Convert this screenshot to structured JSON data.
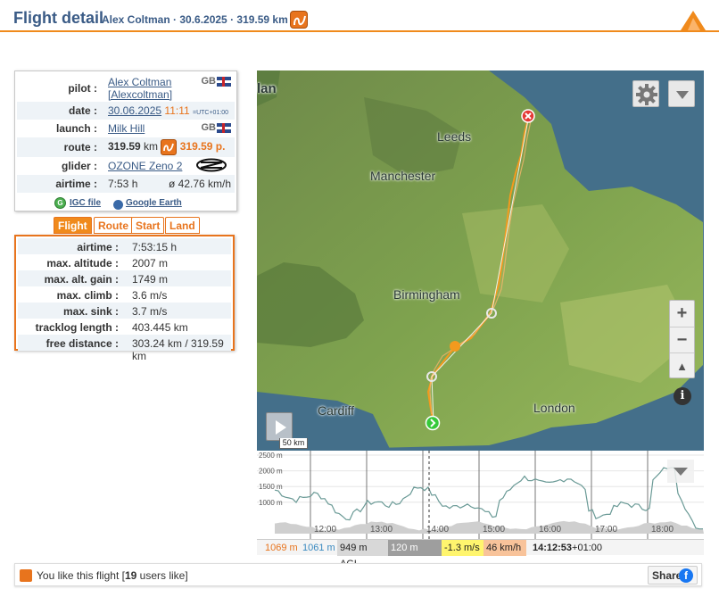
{
  "header": {
    "title": "Flight detail",
    "subtitle": "Alex Coltman · 30.6.2025 · 319.59 km"
  },
  "info": {
    "pilot_label": "pilot :",
    "pilot_name": "Alex Coltman",
    "pilot_handle": "[Alexcoltman]",
    "pilot_country": "GB",
    "date_label": "date :",
    "date_value": "30.06.2025",
    "time_value": "11:11",
    "tz_value": "=UTC+01:00",
    "launch_label": "launch :",
    "launch_value": "Milk Hill",
    "launch_country": "GB",
    "route_label": "route :",
    "route_km": "319.59",
    "route_km_unit": "km",
    "route_points": "319.59",
    "route_points_unit": "p.",
    "glider_label": "glider :",
    "glider_value": "OZONE Zeno 2",
    "airtime_label": "airtime :",
    "airtime_value": "7:53 h",
    "avg_speed": "ø 42.76 km/h",
    "igc_label": "IGC file",
    "google_earth_label": "Google Earth"
  },
  "tabs": [
    {
      "label": "Flight",
      "active": true
    },
    {
      "label": "Route",
      "active": false
    },
    {
      "label": "Start",
      "active": false
    },
    {
      "label": "Land",
      "active": false
    }
  ],
  "stats": [
    {
      "label": "airtime :",
      "value": "7:53:15 h"
    },
    {
      "label": "max. altitude :",
      "value": "2007 m"
    },
    {
      "label": "max. alt. gain :",
      "value": "1749 m"
    },
    {
      "label": "max. climb :",
      "value": "3.6 m/s"
    },
    {
      "label": "max. sink :",
      "value": "3.7 m/s"
    },
    {
      "label": "tracklog length :",
      "value": "403.445 km"
    },
    {
      "label": "free distance :",
      "value": "303.24 km / 319.59 km"
    }
  ],
  "map": {
    "cities": [
      "lan",
      "Leeds",
      "Manchester",
      "Birmingham",
      "Cardiff",
      "London"
    ],
    "scale_label": "50 km",
    "zoom_in": "+",
    "zoom_out": "−",
    "north": "▲",
    "info": "i"
  },
  "chart_data": {
    "type": "area",
    "y_ticks": [
      "2500 m",
      "2000 m",
      "1500 m",
      "1000 m"
    ],
    "x_ticks": [
      "12:00",
      "13:00",
      "14:00",
      "15:00",
      "16:00",
      "17:00",
      "18:00"
    ],
    "ylim": [
      0,
      2500
    ]
  },
  "status": {
    "alt_gps": "1069 m",
    "alt_baro": "1061 m",
    "agl": "949 m AGL",
    "gnd": "120 m GND",
    "vario": "-1.3 m/s",
    "speed": "46 km/h",
    "time": "14:12:53",
    "tz": "+01:00"
  },
  "bottom": {
    "like_prefix": "You like this flight [",
    "like_count": "19",
    "like_suffix": " users like]",
    "share_label": "Share",
    "fb_glyph": "f"
  },
  "colors": {
    "accent": "#f08a1c",
    "link": "#3a5b86",
    "track": "#f39a1e"
  }
}
